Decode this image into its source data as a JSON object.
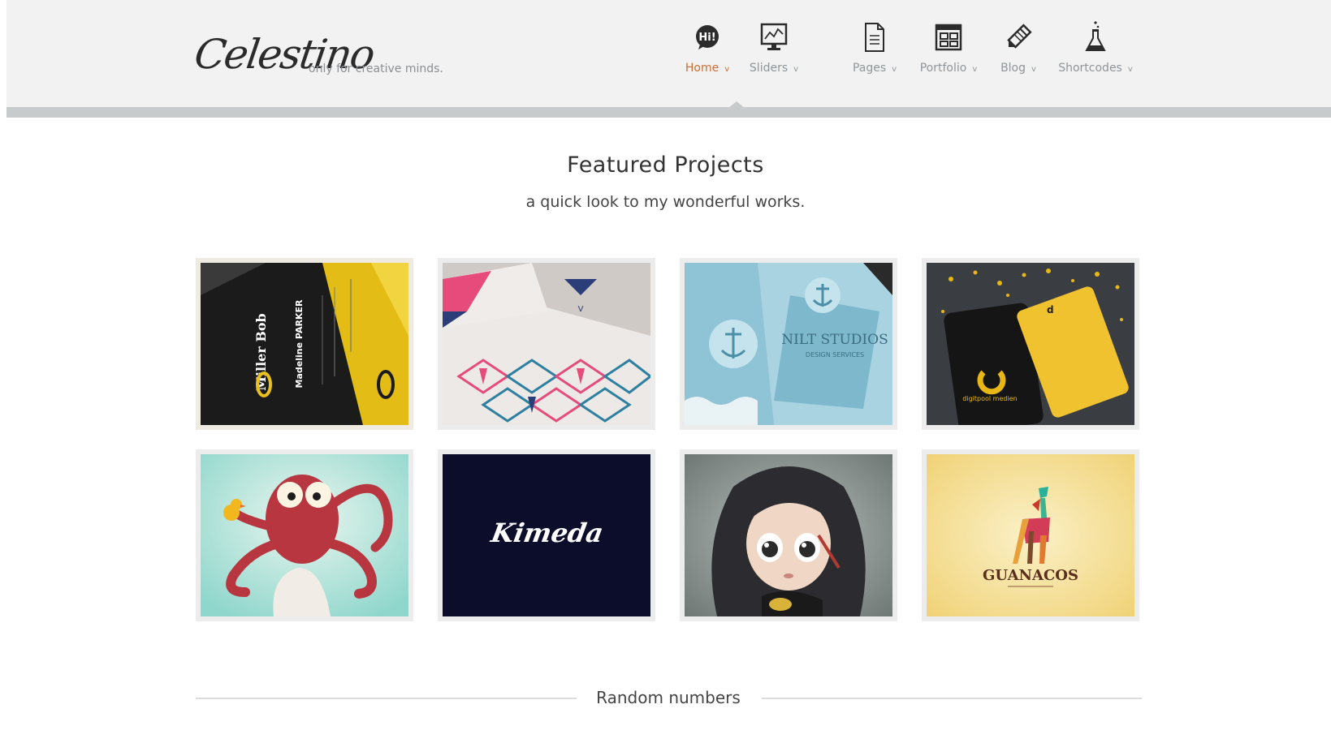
{
  "brand": {
    "name": "Celestino",
    "tagline": "only for creative minds."
  },
  "nav": {
    "items": [
      {
        "label": "Home",
        "icon": "hi-bubble-icon",
        "active": true
      },
      {
        "label": "Sliders",
        "icon": "monitor-chart-icon"
      },
      {
        "label": "Pages",
        "icon": "document-icon"
      },
      {
        "label": "Portfolio",
        "icon": "layout-grid-icon"
      },
      {
        "label": "Blog",
        "icon": "pencil-icon"
      },
      {
        "label": "Shortcodes",
        "icon": "flask-icon"
      }
    ],
    "chevron": "v"
  },
  "featured": {
    "title": "Featured Projects",
    "subtitle": "a quick look to my wonderful works.",
    "items": [
      {
        "name": "miller-bob-business-card",
        "card_name": "Miller Bob",
        "card_person": "Madeline PARKER"
      },
      {
        "name": "pink-geometric-cards",
        "card_name": "V"
      },
      {
        "name": "nilt-studios-cards",
        "card_name": "NILT STUDIOS",
        "card_sub": "DESIGN SERVICES"
      },
      {
        "name": "digitpool-medien-cards",
        "card_name": "digitpool medien"
      },
      {
        "name": "octopus-illustration"
      },
      {
        "name": "kimeda-logo",
        "card_name": "Kimeda"
      },
      {
        "name": "girl-doll-illustration"
      },
      {
        "name": "guanacos-logo",
        "card_name": "GUANACOS"
      }
    ]
  },
  "divider": {
    "label": "Random numbers"
  },
  "colors": {
    "accent": "#c9703a",
    "nav_text": "#8f969b",
    "header_bg": "#f1f2f1"
  }
}
